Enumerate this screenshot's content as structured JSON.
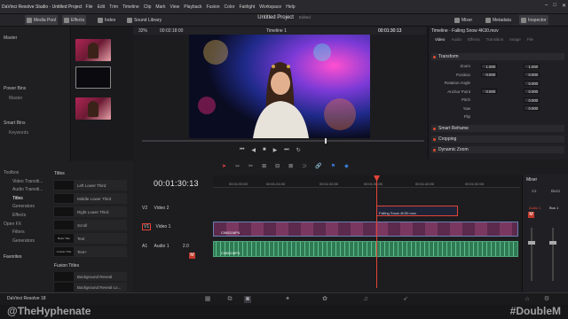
{
  "app": {
    "title": "DaVinci Resolve Studio - Untitled Project",
    "name": "DaVinci Resolve 18"
  },
  "menu": [
    "DaVinci Resolve",
    "File",
    "Edit",
    "Trim",
    "Timeline",
    "Clip",
    "Mark",
    "View",
    "Playback",
    "Fusion",
    "Color",
    "Fairlight",
    "Workspace",
    "Help"
  ],
  "toolbar": {
    "media_pool": "Media Pool",
    "effects": "Effects",
    "index": "Index",
    "sound_library": "Sound Library",
    "project": "Untitled Project",
    "edited": "Edited",
    "mixer": "Mixer",
    "metadata": "Metadata",
    "inspector": "Inspector"
  },
  "bins": {
    "master": "Master",
    "power_bins": "Power Bins",
    "power_master": "Master",
    "smart_bins": "Smart Bins",
    "keywords": "Keywords"
  },
  "clips": [
    {
      "name": "C0653.MP4"
    },
    {
      "name": "Falling Snow 4K30..."
    },
    {
      "name": "Timeline 1"
    }
  ],
  "viewer": {
    "zoom": "32%",
    "duration": "00:02:18:00",
    "timeline": "Timeline 1",
    "timecode": "00:01:30:13"
  },
  "inspector": {
    "header": "Timeline - Falling Snow 4K30.mov",
    "tabs": [
      "Video",
      "Audio",
      "Effects",
      "Transition",
      "Image",
      "File"
    ],
    "transform": "Transform",
    "rows": [
      {
        "label": "Zoom",
        "x": "1.000",
        "y": "1.000"
      },
      {
        "label": "Position",
        "x": "0.000",
        "y": "0.000"
      },
      {
        "label": "Rotation Angle",
        "x": "",
        "y": "0.000"
      },
      {
        "label": "Anchor Point",
        "x": "0.000",
        "y": "0.000"
      },
      {
        "label": "Pitch",
        "x": "",
        "y": "0.000"
      },
      {
        "label": "Yaw",
        "x": "",
        "y": "0.000"
      },
      {
        "label": "Flip",
        "x": "",
        "y": ""
      }
    ],
    "smart_reframe": "Smart Reframe",
    "cropping": "Cropping",
    "dynamic_zoom": "Dynamic Zoom"
  },
  "effects_lib": {
    "tree": [
      "Toolbox",
      "Video Transiti...",
      "Audio Transiti...",
      "Titles",
      "Generators",
      "Effects",
      "Open FX",
      "Filters",
      "Generators"
    ],
    "favorites": "Favorites",
    "titles_header": "Titles",
    "titles": [
      {
        "thumb": "",
        "name": "Left Lower Third"
      },
      {
        "thumb": "",
        "name": "Middle Lower Third"
      },
      {
        "thumb": "",
        "name": "Right Lower Third"
      },
      {
        "thumb": "",
        "name": "Scroll"
      },
      {
        "thumb": "Basic Title",
        "name": "Text"
      },
      {
        "thumb": "Custom Title",
        "name": "Text+"
      }
    ],
    "fusion_titles": "Fusion Titles",
    "fusion_items": [
      "Background Reveal",
      "Background Reveal Lo..."
    ]
  },
  "timeline": {
    "timecode": "00:01:30:13",
    "ruler": [
      "00:01:00:00",
      "00:01:24:00",
      "00:01:32:00",
      "00:01:36:00",
      "00:01:40:00",
      "00:01:52:00"
    ],
    "tracks": [
      {
        "id": "V2",
        "name": "Video 2"
      },
      {
        "id": "V1",
        "name": "Video 1"
      },
      {
        "id": "A1",
        "name": "Audio 1",
        "level": "2.0"
      }
    ],
    "clip_v2": "Falling Snow 4K30.mov",
    "clip_v1": "C0653.MP4",
    "clip_a1": "C0653.MP4"
  },
  "mixer": {
    "title": "Mixer",
    "a1": "A1",
    "bus": "Bus1",
    "audio1": "Audio 1",
    "bus_label": "Bus 1"
  },
  "watermark": {
    "left": "@TheHyphenate",
    "right": "#DoubleM"
  }
}
